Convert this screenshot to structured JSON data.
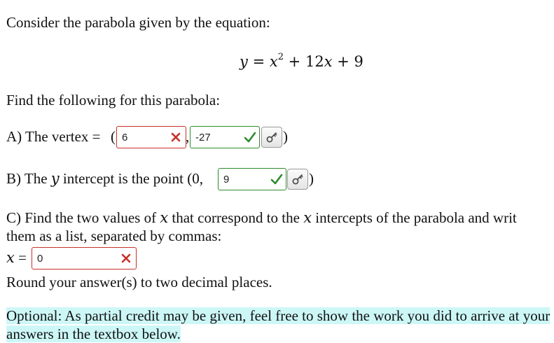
{
  "intro": "Consider the parabola given by the equation:",
  "equation": {
    "lhs": "y",
    "equals": "=",
    "x": "x",
    "exponent": "2",
    "plus1": "+",
    "coef": "12",
    "x2": "x",
    "plus2": "+",
    "const": "9"
  },
  "find_prompt": "Find the following for this parabola:",
  "part_a": {
    "label": "A) The vertex =",
    "open_paren": "(",
    "comma": ",",
    "close_paren": ")",
    "x_value": "6",
    "y_value": "-27"
  },
  "part_b": {
    "label_before": "B) The",
    "var": "y",
    "label_after": "intercept is the point (0,",
    "value": "9",
    "close_paren": ")"
  },
  "part_c": {
    "line1_before": "C) Find the two values of",
    "var1": "x",
    "line1_mid": "that correspond to the",
    "var2": "x",
    "line1_after": "intercepts of the parabola and writ",
    "line2": "them as a list, separated by commas:",
    "answer_var": "x",
    "answer_eq": "=",
    "value": "0"
  },
  "round_note": "Round your answer(s) to two decimal places.",
  "optional_note": "Optional: As partial credit may be given, feel free to show the work you did to arrive at your answers in the textbox below.",
  "colors": {
    "wrong": "#c7302a",
    "correct": "#2e8b2e",
    "highlight": "#cdf7f7"
  },
  "icons": {
    "wrong": "x-mark-icon",
    "correct": "check-mark-icon",
    "key": "key-icon"
  }
}
